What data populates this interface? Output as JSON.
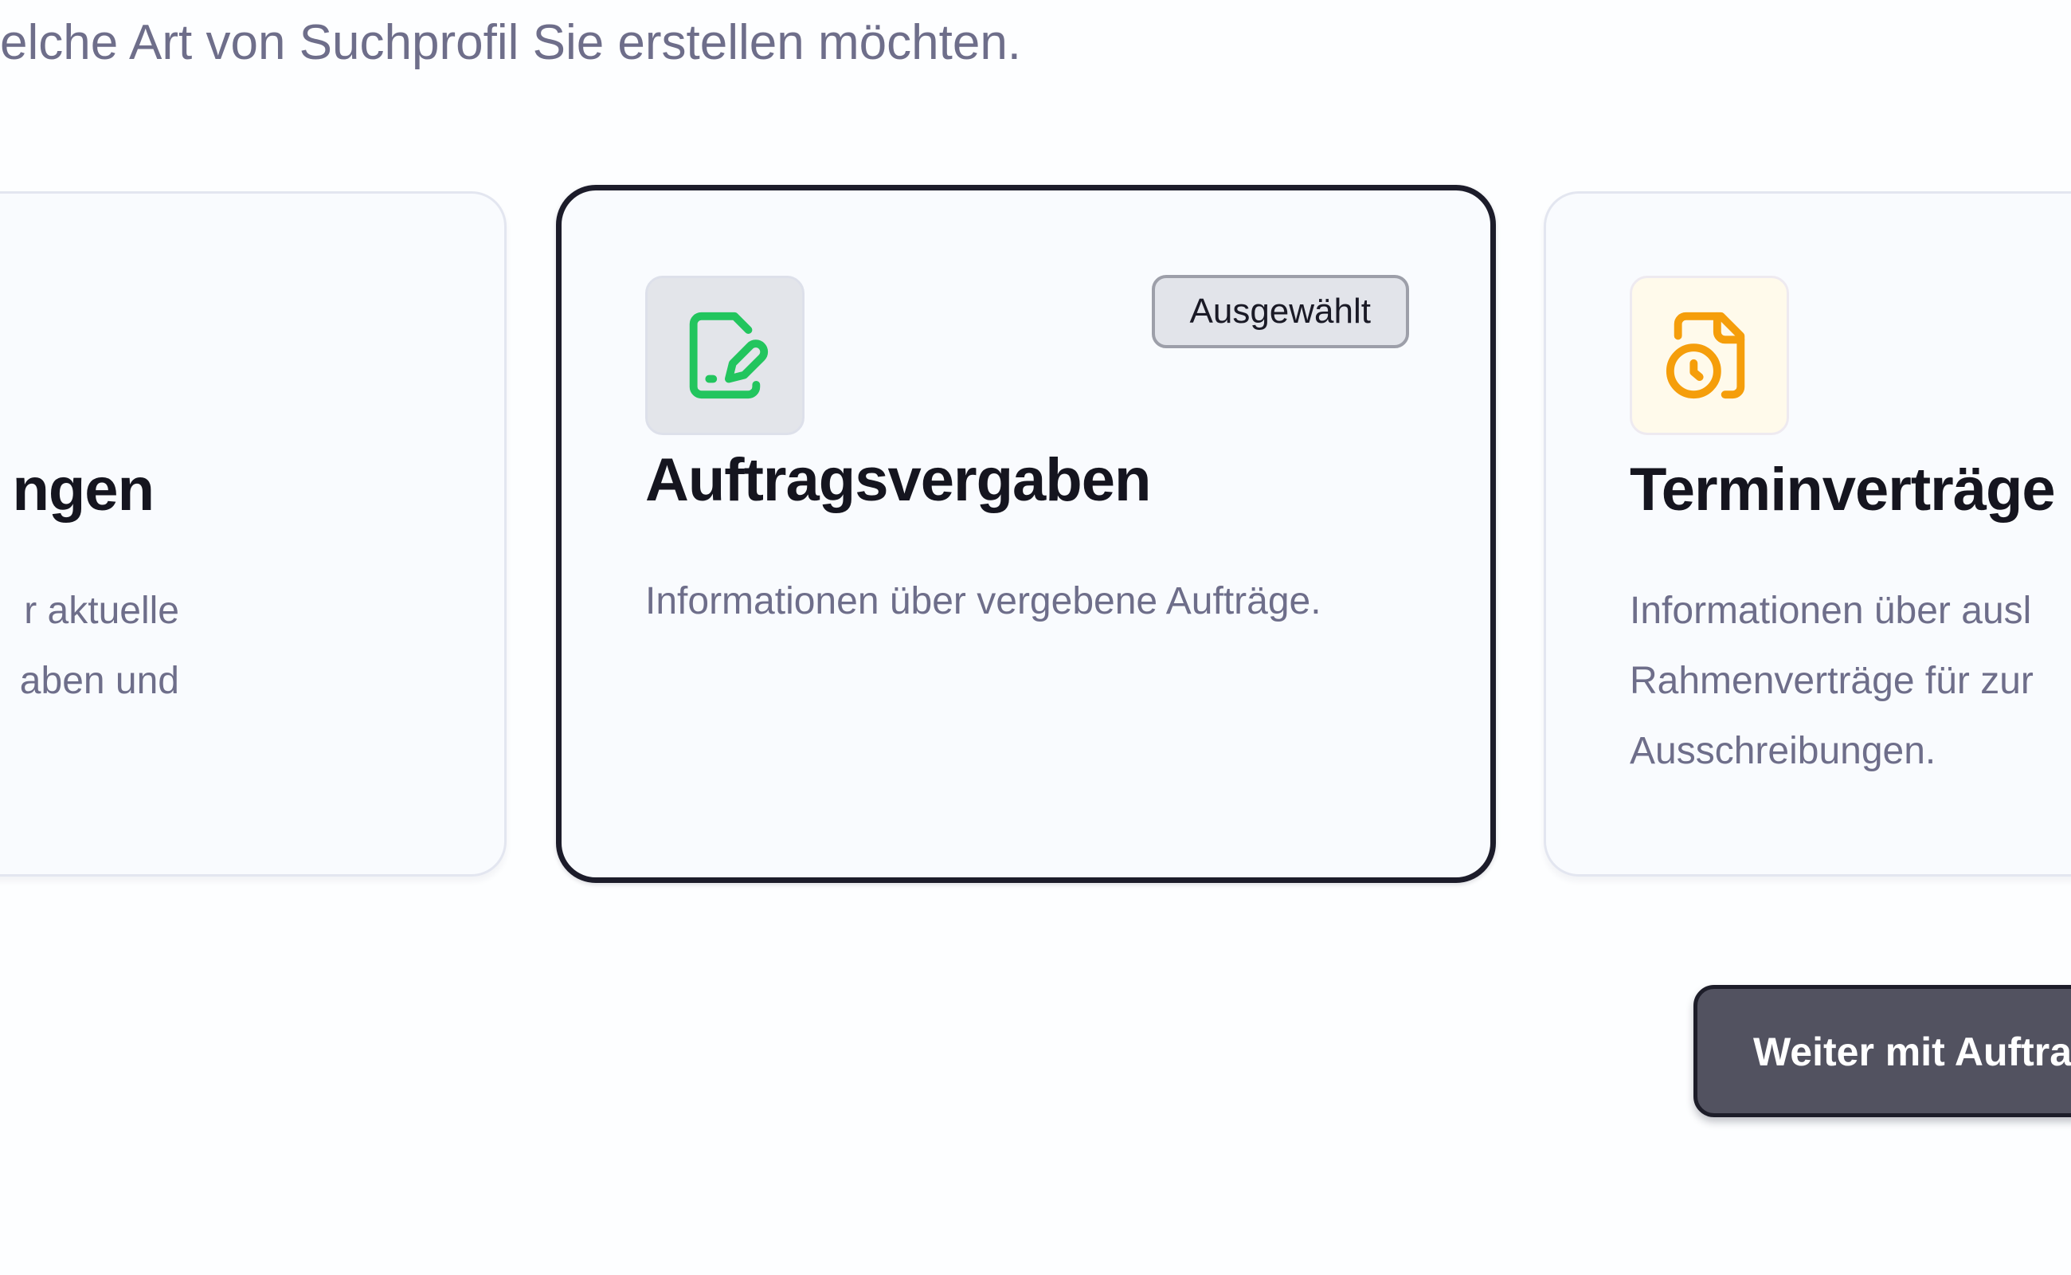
{
  "header": {
    "subtitle": "elche Art von Suchprofil Sie erstellen möchten."
  },
  "cards": [
    {
      "title": "ngen",
      "description_lines": [
        "r aktuelle",
        "aben und"
      ],
      "selected": false
    },
    {
      "title": "Auftragsvergaben",
      "description_lines": [
        "Informationen über vergebene Aufträge."
      ],
      "icon": "file-signature-icon",
      "icon_color": "#22c55e",
      "selected": true,
      "badge_label": "Ausgewählt"
    },
    {
      "title": "Terminverträge",
      "description_lines": [
        "Informationen über ausl",
        "Rahmenverträge für zur",
        "Ausschreibungen."
      ],
      "icon": "file-clock-icon",
      "icon_color": "#f59e0b",
      "selected": false
    }
  ],
  "footer": {
    "continue_label": "Weiter mit Auftra"
  },
  "colors": {
    "background": "#fdfeff",
    "muted_text": "#6e6e8a",
    "heading_text": "#15151f",
    "selected_border": "#1c1c2a",
    "button_bg": "#525260"
  }
}
